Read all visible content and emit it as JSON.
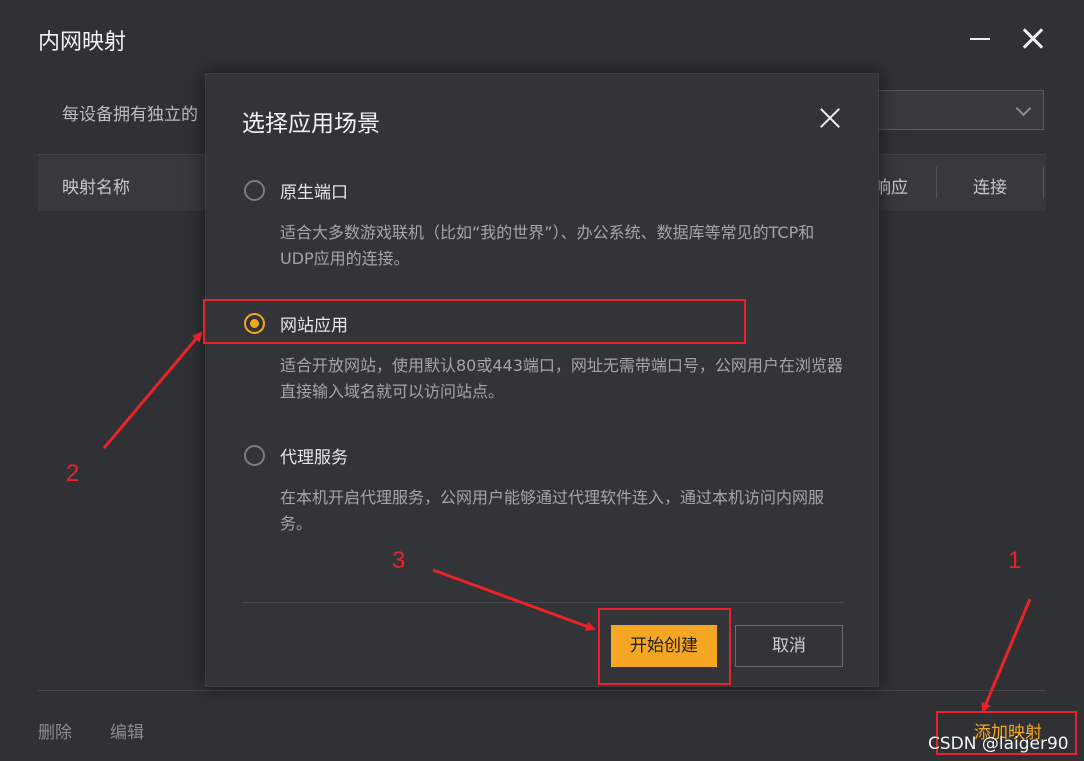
{
  "window": {
    "title": "内网映射"
  },
  "toolbar": {
    "description": "每设备拥有独立的"
  },
  "table": {
    "columns": [
      "映射名称",
      "响应",
      "连接"
    ]
  },
  "footer": {
    "delete_label": "删除",
    "edit_label": "编辑",
    "add_label": "添加映射"
  },
  "dialog": {
    "title": "选择应用场景",
    "options": [
      {
        "label": "原生端口",
        "description": "适合大多数游戏联机（比如“我的世界”）、办公系统、数据库等常见的TCP和UDP应用的连接。",
        "selected": false
      },
      {
        "label": "网站应用",
        "description": "适合开放网站，使用默认80或443端口，网址无需带端口号，公网用户在浏览器直接输入域名就可以访问站点。",
        "selected": true
      },
      {
        "label": "代理服务",
        "description": "在本机开启代理服务，公网用户能够通过代理软件连入，通过本机访问内网服务。",
        "selected": false
      }
    ],
    "confirm_label": "开始创建",
    "cancel_label": "取消"
  },
  "annotations": {
    "step1": "1",
    "step2": "2",
    "step3": "3"
  },
  "watermark": "CSDN @laiger90",
  "colors": {
    "accent": "#f5a623",
    "annotation": "#e8232a",
    "background": "#303134"
  }
}
